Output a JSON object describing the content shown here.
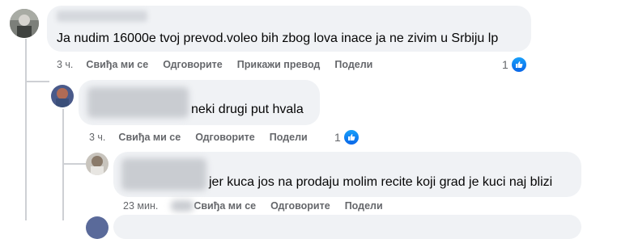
{
  "comments": [
    {
      "text": "Ja nudim 16000e tvoj prevod.voleo bih zbog lova inace ja ne zivim u Srbiju lp",
      "time": "3 ч.",
      "actions": [
        "Свиђа ми се",
        "Одговорите",
        "Прикажи превод",
        "Подели"
      ],
      "reaction_count": "1"
    },
    {
      "text": "neki drugi put hvala",
      "time": "3 ч.",
      "actions": [
        "Свиђа ми се",
        "Одговорите",
        "Подели"
      ],
      "reaction_count": "1"
    },
    {
      "text": "jer kuca jos na prodaju molim recite koji grad je kuci naj blizi",
      "time": "23 мин.",
      "actions": [
        "Свиђа ми се",
        "Одговорите",
        "Подели"
      ]
    }
  ],
  "icons": {
    "reaction": "like-thumb-icon"
  },
  "colors": {
    "bubble": "#f0f2f5",
    "like_blue": "#0a66e8",
    "meta_gray": "#65676b"
  }
}
